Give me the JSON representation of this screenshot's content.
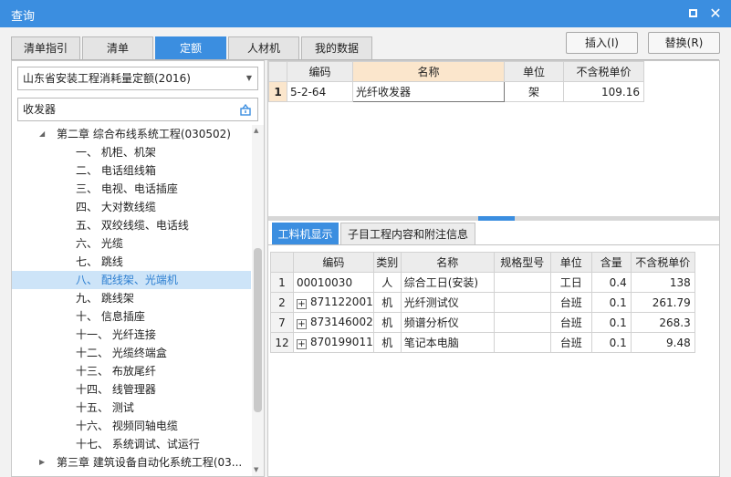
{
  "window": {
    "title": "查询"
  },
  "tabs": [
    {
      "label": "清单指引"
    },
    {
      "label": "清单"
    },
    {
      "label": "定额"
    },
    {
      "label": "人材机"
    },
    {
      "label": "我的数据"
    }
  ],
  "buttons": {
    "insert": "插入(I)",
    "replace": "替换(R)"
  },
  "left": {
    "quota_library": "山东省安装工程消耗量定额(2016)",
    "search_value": "收发器",
    "tree": [
      {
        "label": "第二章 综合布线系统工程(030502)",
        "level": 1,
        "expanded": true
      },
      {
        "label": "一、 机柜、机架",
        "level": 2
      },
      {
        "label": "二、 电话组线箱",
        "level": 2
      },
      {
        "label": "三、 电视、电话插座",
        "level": 2
      },
      {
        "label": "四、 大对数线缆",
        "level": 2
      },
      {
        "label": "五、 双绞线缆、电话线",
        "level": 2
      },
      {
        "label": "六、 光缆",
        "level": 2
      },
      {
        "label": "七、 跳线",
        "level": 2
      },
      {
        "label": "八、 配线架、光端机",
        "level": 2,
        "selected": true
      },
      {
        "label": "九、 跳线架",
        "level": 2
      },
      {
        "label": "十、 信息插座",
        "level": 2
      },
      {
        "label": "十一、 光纤连接",
        "level": 2
      },
      {
        "label": "十二、 光缆终端盒",
        "level": 2
      },
      {
        "label": "十三、 布放尾纤",
        "level": 2
      },
      {
        "label": "十四、 线管理器",
        "level": 2
      },
      {
        "label": "十五、 测试",
        "level": 2
      },
      {
        "label": "十六、 视频同轴电缆",
        "level": 2
      },
      {
        "label": "十七、 系统调试、试运行",
        "level": 2
      },
      {
        "label": "第三章 建筑设备自动化系统工程(03...",
        "level": 1,
        "expanded": false
      }
    ]
  },
  "quota_grid": {
    "headers": [
      "编码",
      "名称",
      "单位",
      "不含税单价"
    ],
    "rows": [
      {
        "index": "1",
        "code": "5-2-64",
        "name": "光纤收发器",
        "unit": "架",
        "price": "109.16"
      }
    ]
  },
  "detail_tabs": [
    {
      "label": "工料机显示"
    },
    {
      "label": "子目工程内容和附注信息"
    }
  ],
  "material_grid": {
    "headers": [
      "编码",
      "类别",
      "名称",
      "规格型号",
      "单位",
      "含量",
      "不含税单价"
    ],
    "rows": [
      {
        "index": "1",
        "code": "00010030",
        "category": "人",
        "name": "综合工日(安装)",
        "spec": "",
        "unit": "工日",
        "qty": "0.4",
        "price": "138",
        "expand": false
      },
      {
        "index": "2",
        "code": "871122001",
        "category": "机",
        "name": "光纤测试仪",
        "spec": "",
        "unit": "台班",
        "qty": "0.1",
        "price": "261.79",
        "expand": true
      },
      {
        "index": "7",
        "code": "873146002",
        "category": "机",
        "name": "频谱分析仪",
        "spec": "",
        "unit": "台班",
        "qty": "0.1",
        "price": "268.3",
        "expand": true
      },
      {
        "index": "12",
        "code": "870199011",
        "category": "机",
        "name": "笔记本电脑",
        "spec": "",
        "unit": "台班",
        "qty": "0.1",
        "price": "9.48",
        "expand": true
      }
    ]
  },
  "colors": {
    "accent": "#3b8ee0",
    "selected_row": "#cde4f8",
    "highlight_header": "#fbe6cc"
  }
}
